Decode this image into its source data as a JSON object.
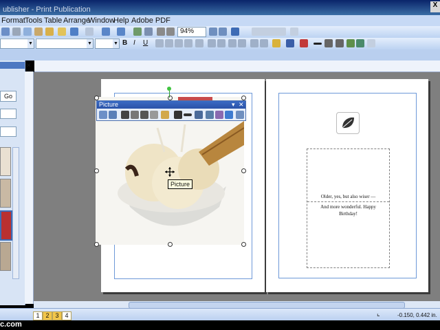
{
  "window": {
    "title": "ublisher - Print Publication",
    "close_glyph": "X"
  },
  "menus": [
    "Format",
    "Tools",
    "Table",
    "Arrange",
    "Window",
    "Help",
    "Adobe PDF"
  ],
  "toolbar": {
    "zoom": "94%"
  },
  "left_pane": {
    "go_label": "Go"
  },
  "picture_toolbar": {
    "title": "Picture"
  },
  "tooltip": "Picture",
  "greeting": {
    "line1": "Older, yes, but also wiser —",
    "line2": "And more wonderful.  Happy",
    "line3": "Birthday!"
  },
  "pages": [
    "1",
    "2",
    "3",
    "4"
  ],
  "status": {
    "coords": "-0.150, 0.442 in."
  },
  "watermark": "c.com",
  "colors": {
    "accent": "#3b6bc4",
    "page_tab_active": "#f3c64a"
  }
}
